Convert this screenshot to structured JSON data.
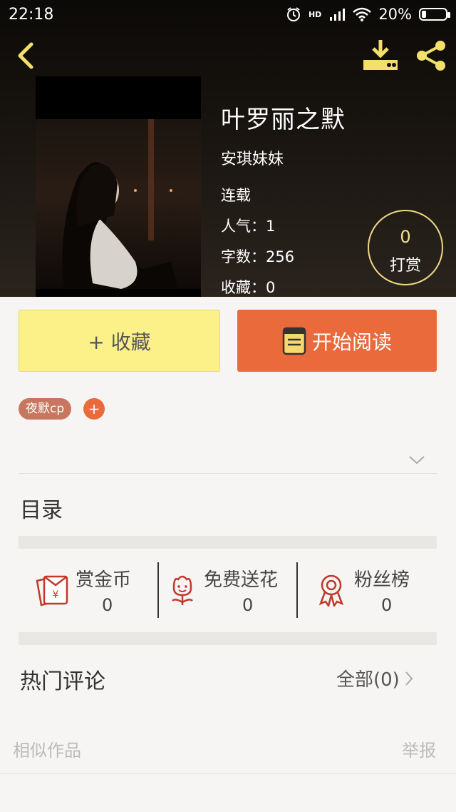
{
  "status_bar": {
    "time": "22:18",
    "network": "HD",
    "battery": "20%",
    "battery_level": 0.2
  },
  "book": {
    "title": "叶罗丽之默",
    "author": "安琪妹妹",
    "status": "连载",
    "popularity": "人气：1",
    "word_count": "字数：256",
    "favorites": "收藏：0"
  },
  "tip": {
    "count": "0",
    "label": "打赏"
  },
  "actions": {
    "collect_label": "+ 收藏",
    "read_label": "开始阅读"
  },
  "tags": [
    "夜默cp"
  ],
  "tag_add": "+",
  "toc": {
    "title": "目录"
  },
  "stats": [
    {
      "label": "赏金币",
      "value": "0",
      "icon": "red-envelope-icon"
    },
    {
      "label": "免费送花",
      "value": "0",
      "icon": "flower-icon"
    },
    {
      "label": "粉丝榜",
      "value": "0",
      "icon": "medal-icon"
    }
  ],
  "comments": {
    "title": "热门评论",
    "more": "全部(0)"
  },
  "footer": {
    "similar": "相似作品",
    "report": "举报"
  },
  "colors": {
    "accent": "#ea6a3c",
    "collect": "#fcf089",
    "icon_yellow": "#f3e06a",
    "icon_red": "#c0392b"
  }
}
